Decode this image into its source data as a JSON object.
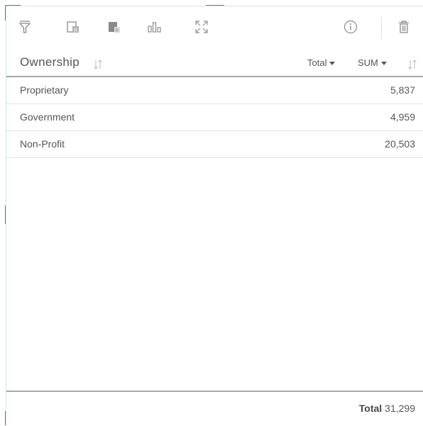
{
  "toolbar": {
    "icons": [
      "filter-icon",
      "card-flip-back-icon",
      "card-flip-front-icon",
      "visualization-type-icon",
      "maximize-icon",
      "info-icon",
      "trash-icon"
    ]
  },
  "table": {
    "category_header": "Ownership",
    "aggregation_label": "Total",
    "statistic_label": "SUM",
    "rows": [
      {
        "category": "Proprietary",
        "value": "5,837"
      },
      {
        "category": "Government",
        "value": "4,959"
      },
      {
        "category": "Non-Profit",
        "value": "20,503"
      }
    ],
    "footer_label": "Total",
    "footer_value": "31,299"
  },
  "colors": {
    "icon": "#8a8a8a",
    "text": "#555555",
    "rule": "#a8a8a8",
    "accent_border": "#cfe3f3"
  }
}
